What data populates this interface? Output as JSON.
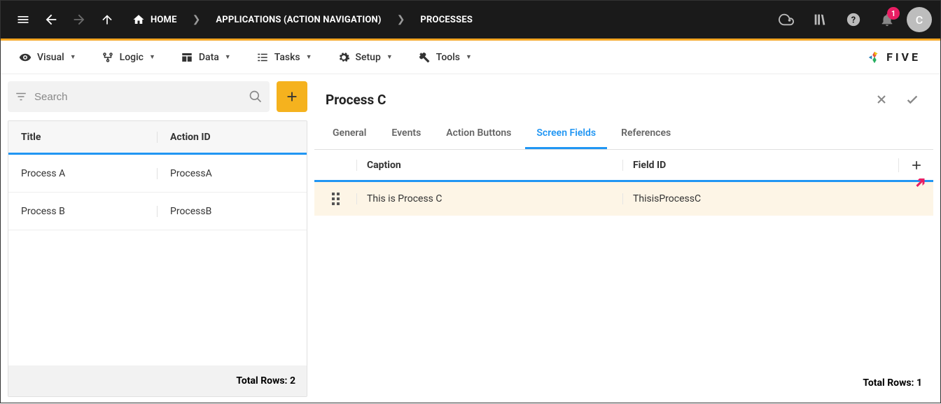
{
  "topbar": {
    "breadcrumbs": [
      {
        "label": "HOME"
      },
      {
        "label": "APPLICATIONS (ACTION NAVIGATION)"
      },
      {
        "label": "PROCESSES"
      }
    ],
    "notification_count": "1",
    "avatar_initial": "C"
  },
  "menubar": {
    "items": [
      {
        "label": "Visual"
      },
      {
        "label": "Logic"
      },
      {
        "label": "Data"
      },
      {
        "label": "Tasks"
      },
      {
        "label": "Setup"
      },
      {
        "label": "Tools"
      }
    ],
    "logo_text": "FIVE"
  },
  "left": {
    "search_placeholder": "Search",
    "columns": {
      "title": "Title",
      "action_id": "Action ID"
    },
    "rows": [
      {
        "title": "Process A",
        "action_id": "ProcessA"
      },
      {
        "title": "Process B",
        "action_id": "ProcessB"
      }
    ],
    "footer": "Total Rows: 2"
  },
  "right": {
    "title": "Process C",
    "tabs": [
      {
        "label": "General"
      },
      {
        "label": "Events"
      },
      {
        "label": "Action Buttons"
      },
      {
        "label": "Screen Fields",
        "active": true
      },
      {
        "label": "References"
      }
    ],
    "columns": {
      "caption": "Caption",
      "field_id": "Field ID"
    },
    "rows": [
      {
        "caption": "This is Process C",
        "field_id": "ThisisProcessC"
      }
    ],
    "footer": "Total Rows: 1"
  }
}
